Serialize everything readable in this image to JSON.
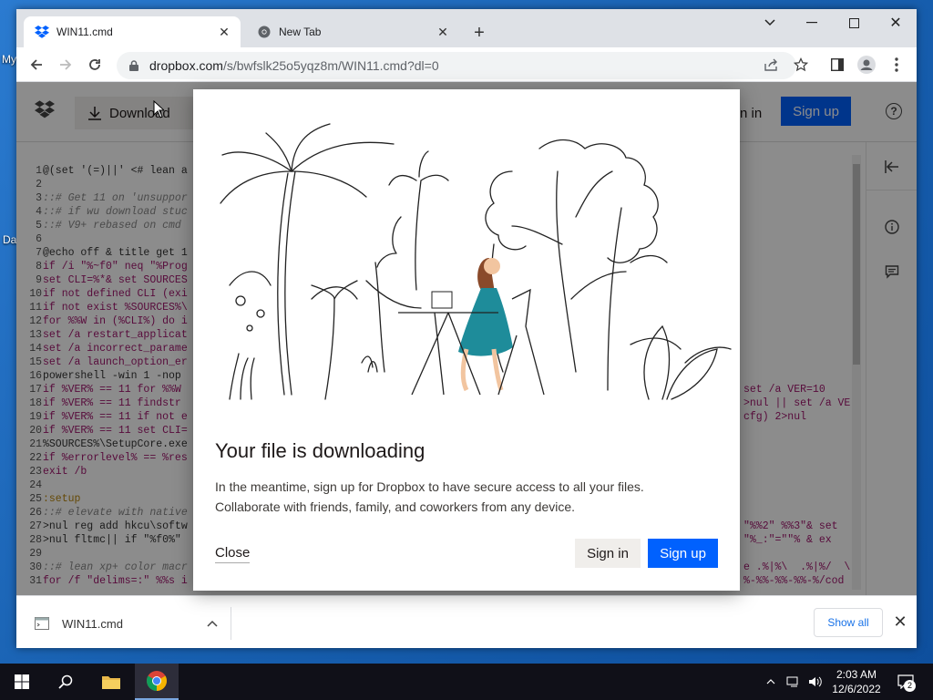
{
  "desktop": {
    "label1": "My",
    "label2": "Da"
  },
  "browser": {
    "tabs": [
      {
        "title": "WIN11.cmd",
        "icon": "dropbox-icon"
      },
      {
        "title": "New Tab",
        "icon": "chrome-icon"
      }
    ],
    "address": {
      "host": "dropbox.com",
      "path": "/s/bwfslk25o5yqz8m/WIN11.cmd?dl=0"
    }
  },
  "dropbox_header": {
    "download_label": "Download",
    "signin_label": "n in",
    "signup_label": "Sign up",
    "help_glyph": "?"
  },
  "code_lines": [
    {
      "n": "1",
      "t": "@(set '(=)||' <# lean a"
    },
    {
      "n": "2",
      "t": ""
    },
    {
      "n": "3",
      "t": "::# Get 11 on 'unsuppor"
    },
    {
      "n": "4",
      "t": "::# if wu download stuc"
    },
    {
      "n": "5",
      "t": "::# V9+ rebased on cmd"
    },
    {
      "n": "6",
      "t": ""
    },
    {
      "n": "7",
      "t": "@echo off & title get 1"
    },
    {
      "n": "8",
      "t": "if /i \"%~f0\" neq \"%Prog"
    },
    {
      "n": "9",
      "t": "set CLI=%*& set SOURCES"
    },
    {
      "n": "10",
      "t": "if not defined CLI (exi"
    },
    {
      "n": "11",
      "t": "if not exist %SOURCES%\\"
    },
    {
      "n": "12",
      "t": "for %%W in (%CLI%) do i"
    },
    {
      "n": "13",
      "t": "set /a restart_applicat"
    },
    {
      "n": "14",
      "t": "set /a incorrect_parame"
    },
    {
      "n": "15",
      "t": "set /a launch_option_er"
    },
    {
      "n": "16",
      "t": "powershell -win 1 -nop"
    },
    {
      "n": "17",
      "t": "if %VER% == 11 for %%W"
    },
    {
      "n": "18",
      "t": "if %VER% == 11 findstr"
    },
    {
      "n": "19",
      "t": "if %VER% == 11 if not e"
    },
    {
      "n": "20",
      "t": "if %VER% == 11 set CLI="
    },
    {
      "n": "21",
      "t": "%SOURCES%\\SetupCore.exe"
    },
    {
      "n": "22",
      "t": "if %errorlevel% == %res"
    },
    {
      "n": "23",
      "t": "exit /b"
    },
    {
      "n": "24",
      "t": ""
    },
    {
      "n": "25",
      "t": ":setup"
    },
    {
      "n": "26",
      "t": "::# elevate with native"
    },
    {
      "n": "27",
      "t": ">nul reg add hkcu\\softw"
    },
    {
      "n": "28",
      "t": ">nul fltmc|| if \"%f0%\""
    },
    {
      "n": "29",
      "t": ""
    },
    {
      "n": "30",
      "t": "::# lean xp+ color macr"
    },
    {
      "n": "31",
      "t": "for /f \"delims=:\" %%s i"
    }
  ],
  "code_right_lines": [
    {
      "row": 16,
      "t": "set /a VER=10"
    },
    {
      "row": 17,
      "t": ">nul || set /a VE"
    },
    {
      "row": 18,
      "t": "cfg) 2>nul"
    },
    {
      "row": 26,
      "t": "\"%%2\" %%3\"& set"
    },
    {
      "row": 27,
      "t": "\"%_:\"=\"\"% & ex"
    },
    {
      "row": 29,
      "t": "e .%|%\\  .%|%/  \\"
    },
    {
      "row": 30,
      "t": "%-%%-%%-%%-%/cod"
    }
  ],
  "modal": {
    "title": "Your file is downloading",
    "body": "In the meantime, sign up for Dropbox to have secure access to all your files. Collaborate with friends, family, and coworkers from any device.",
    "close_label": "Close",
    "signin_label": "Sign in",
    "signup_label": "Sign up"
  },
  "download_shelf": {
    "filename": "WIN11.cmd",
    "show_all": "Show all"
  },
  "taskbar": {
    "time": "2:03 AM",
    "date": "12/6/2022",
    "notification_count": "2"
  },
  "colors": {
    "dropbox_blue": "#0061fe",
    "taskbar": "#101018",
    "tab_bar": "#dee1e6"
  }
}
